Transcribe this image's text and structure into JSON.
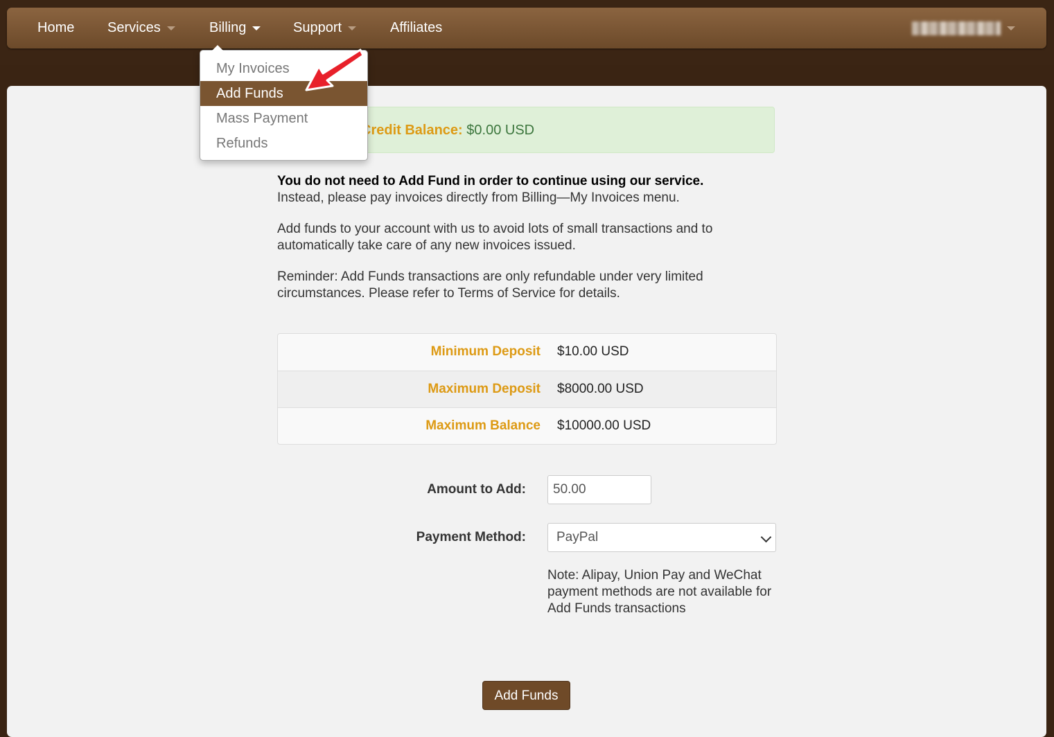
{
  "nav": {
    "items": [
      {
        "label": "Home"
      },
      {
        "label": "Services"
      },
      {
        "label": "Billing"
      },
      {
        "label": "Support"
      },
      {
        "label": "Affiliates"
      }
    ]
  },
  "billing_menu": {
    "items": [
      "My Invoices",
      "Add Funds",
      "Mass Payment",
      "Refunds"
    ],
    "active": "Add Funds"
  },
  "credit": {
    "label": "Credit Balance:",
    "value": "$0.00 USD"
  },
  "notice": {
    "bold": "You do not need to Add Fund in order to continue using our service.",
    "line2": "Instead, please pay invoices directly from Billing—My Invoices menu.",
    "para2": "Add funds to your account with us to avoid lots of small transactions and to automatically take care of any new invoices issued.",
    "para3": "Reminder: Add Funds transactions are only refundable under very limited circumstances. Please refer to Terms of Service for details."
  },
  "limits": [
    {
      "label": "Minimum Deposit",
      "value": "$10.00 USD"
    },
    {
      "label": "Maximum Deposit",
      "value": "$8000.00 USD"
    },
    {
      "label": "Maximum Balance",
      "value": "$10000.00 USD"
    }
  ],
  "form": {
    "amount_label": "Amount to Add:",
    "amount_value": "50.00",
    "method_label": "Payment Method:",
    "method_value": "PayPal",
    "note": "Note: Alipay, Union Pay and WeChat payment methods are not available for Add Funds transactions",
    "submit": "Add Funds"
  },
  "colors": {
    "nav_brown": "#7a5531",
    "label_gold": "#dd9a14",
    "alert_green_bg": "#dff0d8",
    "arrow_red": "#e8202a"
  }
}
